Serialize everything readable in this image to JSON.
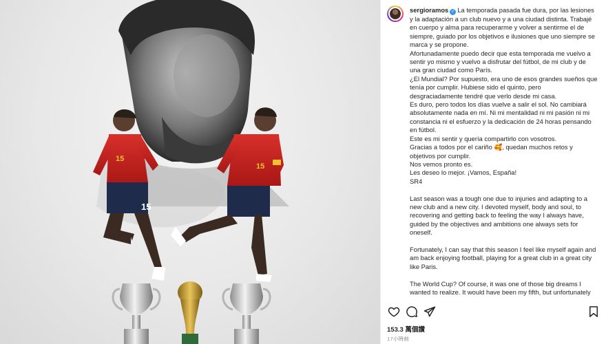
{
  "post": {
    "username": "sergioramos",
    "verified": true,
    "caption_lines": [
      "La temporada pasada fue dura, por las lesiones",
      "y la adaptación a un club nuevo y a una ciudad distinta. Trabajé",
      "en cuerpo y alma para recuperarme y volver a sentirme el de",
      "siempre, guiado por los objetivos e ilusiones que uno siempre se",
      "marca y se propone.",
      "Afortunadamente puedo decir que esta temporada me vuelvo a",
      "sentir yo mismo y vuelvo a disfrutar del fútbol, de mi club y de",
      "una gran ciudad como París.",
      "¿El Mundial? Por supuesto, era uno de esos grandes sueños que",
      "tenía por cumplir. Hubiese sido el quinto, pero",
      "desgraciadamente tendré que verlo desde mi casa.",
      "Es duro, pero todos los días vuelve a salir el sol. No cambiará",
      "absolutamente nada en mí. Ni mi mentalidad ni mi pasión ni mi",
      "constancia ni el esfuerzo y la dedicación de 24 horas pensando",
      "en fútbol.",
      "Este es mi sentir y quería compartirlo con vosotros.",
      "Gracias a todos por el cariño 🥰, quedan muchos retos y",
      "objetivos por cumplir.",
      "Nos vemos pronto es.",
      "Les deseo lo mejor. ¡Vamos, España!",
      "SR4",
      "",
      "Last season was a tough one due to injuries and adapting to a",
      "new club and a new city. I devoted myself, body and soul, to",
      "recovering and getting back to feeling the way I always have,",
      "guided by the objectives and ambitions one always sets for",
      "oneself.",
      "",
      "Fortunately, I can say that this season I feel like myself again and",
      "am back enjoying football, playing for a great club in a great city",
      "like Paris.",
      "",
      "The World Cup? Of course, it was one of those big dreams I",
      "wanted to realize. It would have been my fifth, but unfortunately"
    ],
    "views": "153.3 萬個讚",
    "timestamp": "17小時前"
  },
  "media": {
    "jersey_numbers": [
      "15",
      "15",
      "15"
    ]
  },
  "icons": {
    "like": "heart-icon",
    "comment": "comment-icon",
    "share": "share-icon",
    "save": "bookmark-icon"
  },
  "colors": {
    "jersey_red": "#c8201e",
    "jersey_yellow": "#f2c230",
    "verified_blue": "#3897f0",
    "trophy_gold": "#c9a032"
  }
}
